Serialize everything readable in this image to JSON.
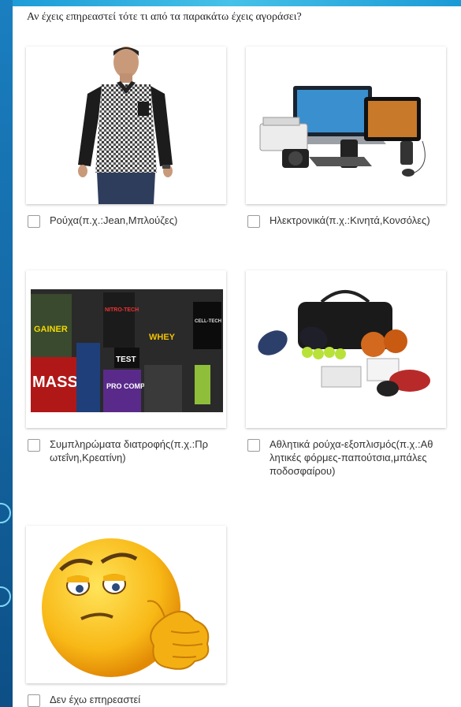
{
  "question": "Αν έχεις επηρεαστεί τότε τι από τα παρακάτω έχεις αγοράσει?",
  "options": [
    {
      "label": "Ρούχα(π.χ.:Jean,Μπλούζες)",
      "image": "shirt-photo",
      "checked": false
    },
    {
      "label": "Ηλεκτρονικά(π.χ.:Κινητά,Κονσόλες)",
      "image": "electronics-photo",
      "checked": false
    },
    {
      "label": "Συμπληρώματα διατροφής(π.χ.:Πρωτεΐνη,Κρεατίνη)",
      "image": "supplements-photo",
      "checked": false,
      "product_texts": [
        "GAINER",
        "MASS",
        "NITRO-TECH",
        "WHEY",
        "TEST",
        "PRO COMPLEX",
        "CELL-TECH"
      ]
    },
    {
      "label": "Αθλητικά ρούχα-εξοπλισμός(π.χ.:Αθλητικές φόρμες-παπούτσια,μπάλες ποδοσφαίρου)",
      "image": "sports-equipment-photo",
      "checked": false
    },
    {
      "label": "Δεν έχω επηρεαστεί",
      "image": "thinking-emoji",
      "checked": false
    }
  ],
  "colors": {
    "accent": "#1a6fa8",
    "checkbox_border": "#9a9a9a"
  }
}
